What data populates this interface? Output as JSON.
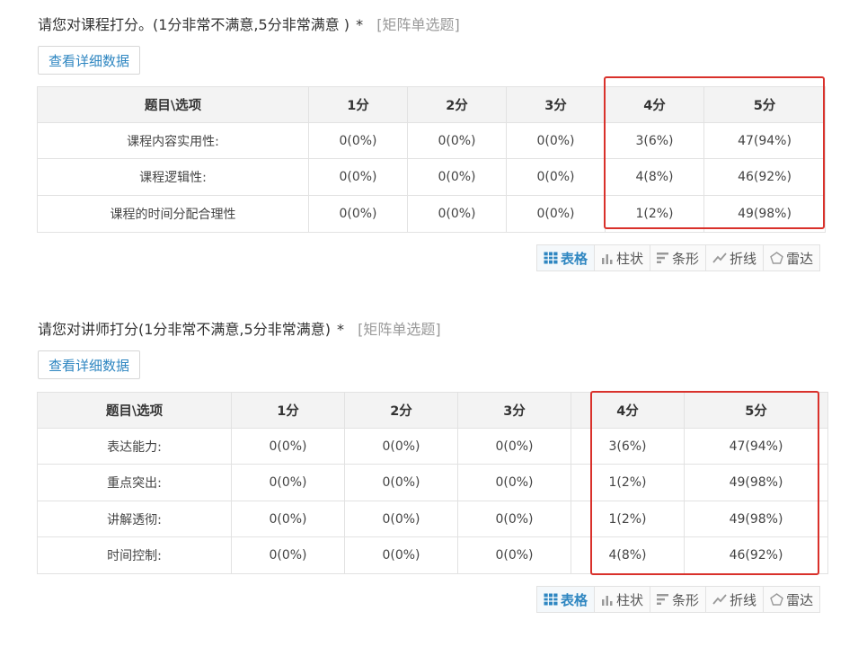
{
  "question1": {
    "title": "请您对课程打分。(1分非常不满意,5分非常满意 )",
    "required_mark": "*",
    "type_label": "[矩阵单选题]",
    "detail_button": "查看详细数据",
    "columns": [
      "题目\\选项",
      "1分",
      "2分",
      "3分",
      "4分",
      "5分"
    ],
    "rows": [
      {
        "label": "课程内容实用性:",
        "cells": [
          "0(0%)",
          "0(0%)",
          "0(0%)",
          "3(6%)",
          "47(94%)"
        ]
      },
      {
        "label": "课程逻辑性:",
        "cells": [
          "0(0%)",
          "0(0%)",
          "0(0%)",
          "4(8%)",
          "46(92%)"
        ]
      },
      {
        "label": "课程的时间分配合理性",
        "cells": [
          "0(0%)",
          "0(0%)",
          "0(0%)",
          "1(2%)",
          "49(98%)"
        ]
      }
    ],
    "view_tabs": [
      {
        "label": "表格",
        "icon": "table-icon",
        "active": true
      },
      {
        "label": "柱状",
        "icon": "bar-chart-icon",
        "active": false
      },
      {
        "label": "条形",
        "icon": "horizontal-bar-icon",
        "active": false
      },
      {
        "label": "折线",
        "icon": "line-chart-icon",
        "active": false
      },
      {
        "label": "雷达",
        "icon": "radar-icon",
        "active": false
      }
    ]
  },
  "question2": {
    "title": "请您对讲师打分(1分非常不满意,5分非常满意)",
    "required_mark": "*",
    "type_label": "[矩阵单选题]",
    "detail_button": "查看详细数据",
    "columns": [
      "题目\\选项",
      "1分",
      "2分",
      "3分",
      "4分",
      "5分"
    ],
    "rows": [
      {
        "label": "表达能力:",
        "cells": [
          "0(0%)",
          "0(0%)",
          "0(0%)",
          "3(6%)",
          "47(94%)"
        ]
      },
      {
        "label": "重点突出:",
        "cells": [
          "0(0%)",
          "0(0%)",
          "0(0%)",
          "1(2%)",
          "49(98%)"
        ]
      },
      {
        "label": "讲解透彻:",
        "cells": [
          "0(0%)",
          "0(0%)",
          "0(0%)",
          "1(2%)",
          "49(98%)"
        ]
      },
      {
        "label": "时间控制:",
        "cells": [
          "0(0%)",
          "0(0%)",
          "0(0%)",
          "4(8%)",
          "46(92%)"
        ]
      }
    ],
    "view_tabs": [
      {
        "label": "表格",
        "icon": "table-icon",
        "active": true
      },
      {
        "label": "柱状",
        "icon": "bar-chart-icon",
        "active": false
      },
      {
        "label": "条形",
        "icon": "horizontal-bar-icon",
        "active": false
      },
      {
        "label": "折线",
        "icon": "line-chart-icon",
        "active": false
      },
      {
        "label": "雷达",
        "icon": "radar-icon",
        "active": false
      }
    ]
  },
  "colors": {
    "link_blue": "#2e86c1",
    "highlight_red": "#d9312b",
    "header_bg": "#f3f3f3"
  }
}
